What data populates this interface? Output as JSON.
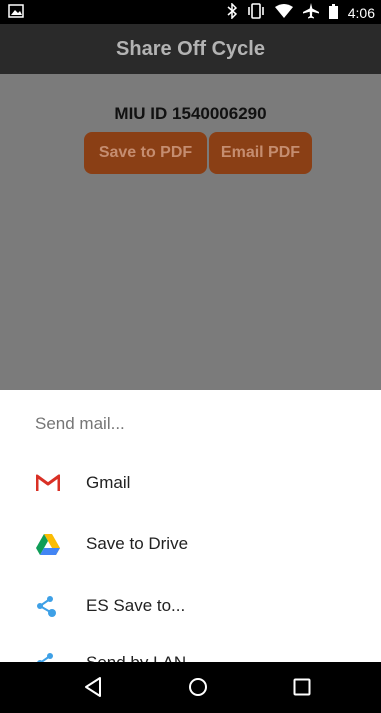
{
  "status_bar": {
    "time": "4:06",
    "icons": [
      "image-icon",
      "bluetooth-icon",
      "vibrate-icon",
      "wifi-icon",
      "airplane-icon",
      "battery-icon"
    ]
  },
  "app_bar": {
    "title": "Share Off Cycle"
  },
  "main": {
    "miu_label": "MIU ID 1540006290",
    "save_pdf_label": "Save to PDF",
    "email_pdf_label": "Email PDF"
  },
  "share_sheet": {
    "title": "Send mail...",
    "items": [
      {
        "label": "Gmail",
        "icon": "gmail-icon"
      },
      {
        "label": "Save to Drive",
        "icon": "google-drive-icon"
      },
      {
        "label": "ES Save to...",
        "icon": "es-share-icon"
      },
      {
        "label": "Send by LAN",
        "icon": "es-share-icon"
      }
    ]
  },
  "nav_bar": {
    "icons": [
      "back-icon",
      "home-icon",
      "recents-icon"
    ]
  },
  "colors": {
    "app_bar_bg": "#2a2a2a",
    "content_bg": "#7b7b7b",
    "button_bg": "#8a3f15",
    "button_text": "#c58d70"
  }
}
